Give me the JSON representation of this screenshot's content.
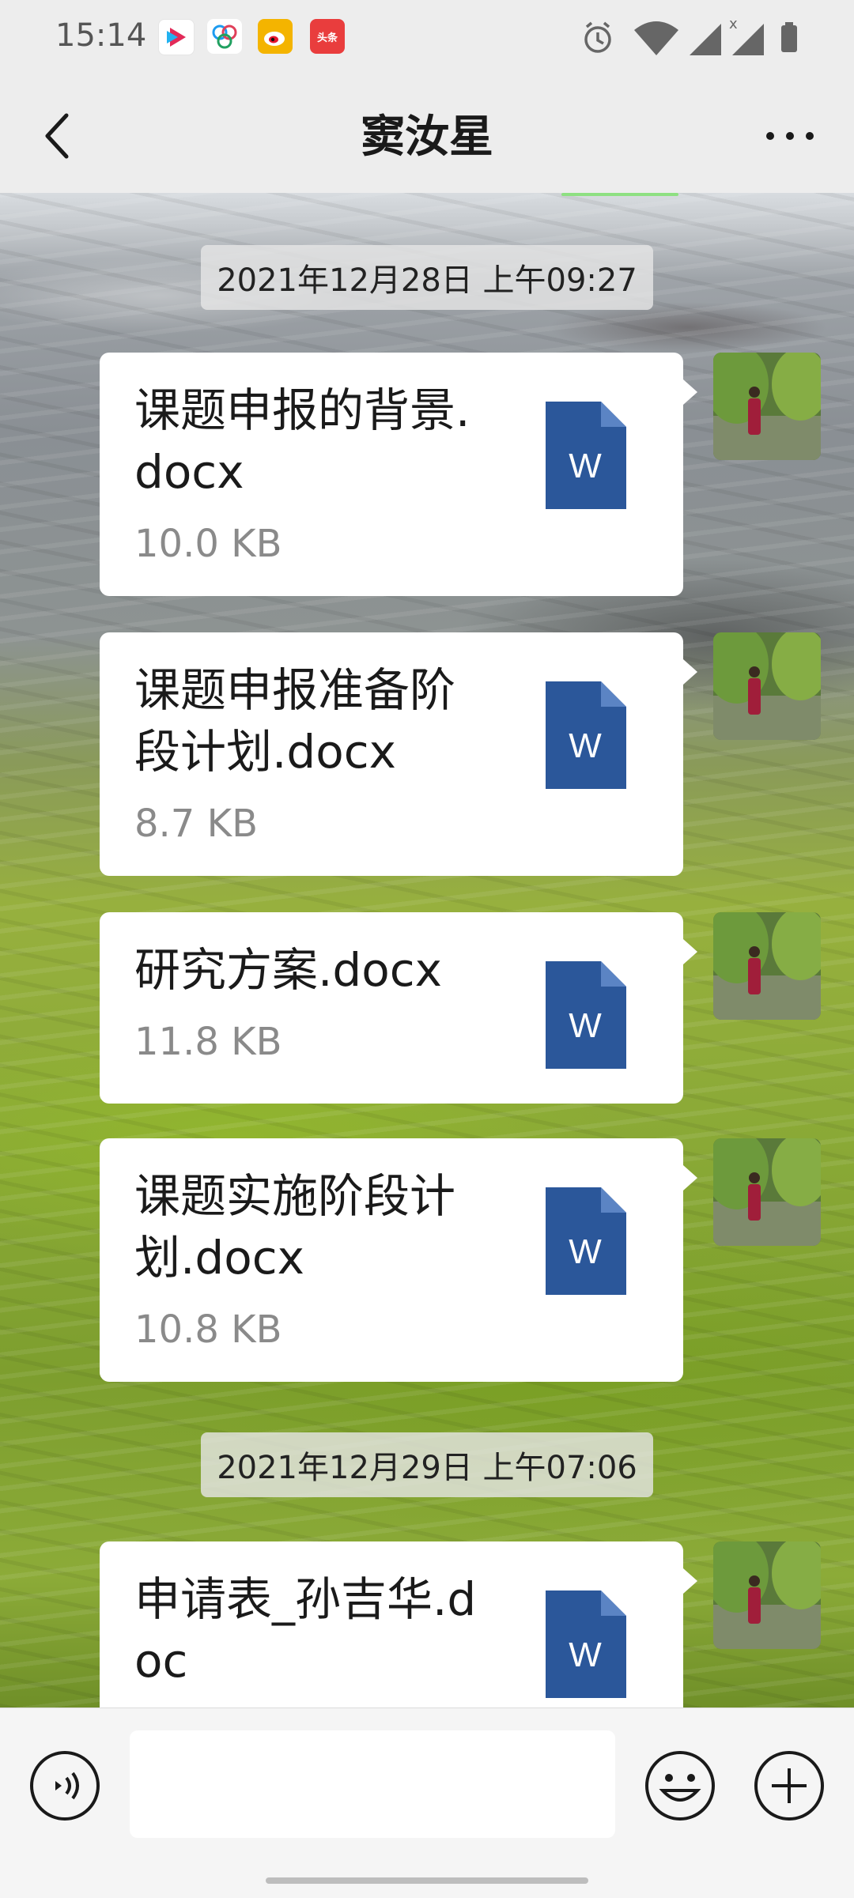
{
  "status_bar": {
    "time": "15:14",
    "apps": [
      {
        "icon": "youku-icon",
        "label": "YOUKU",
        "color": "#1fb6f2"
      },
      {
        "icon": "qq-app-icon",
        "label": "",
        "color": "#ffffff"
      },
      {
        "icon": "weibo-icon",
        "label": "",
        "color": "#f0b000"
      },
      {
        "icon": "toutiao-icon",
        "label": "头条",
        "color": "#e93d3d"
      }
    ],
    "right_icons": [
      "alarm-icon",
      "wifi-icon",
      "signal-icon",
      "signal-no-sim-icon",
      "battery-icon"
    ]
  },
  "header": {
    "title": "窦汝星",
    "back_icon": "chevron-left-icon",
    "more_icon": "more-dots-icon"
  },
  "chat": {
    "groups": [
      {
        "timestamp": "2021年12月28日 上午09:27",
        "messages": [
          {
            "file_name": "课题申报的背景.docx",
            "size": "10.0 KB",
            "file_icon": "word-doc-icon"
          },
          {
            "file_name": "课题申报准备阶段计划.docx",
            "size": "8.7 KB",
            "file_icon": "word-doc-icon"
          },
          {
            "file_name": "研究方案.docx",
            "size": "11.8 KB",
            "file_icon": "word-doc-icon"
          },
          {
            "file_name": "课题实施阶段计划.docx",
            "size": "10.8 KB",
            "file_icon": "word-doc-icon"
          }
        ]
      },
      {
        "timestamp": "2021年12月29日 上午07:06",
        "messages": [
          {
            "file_name": "申请表_孙吉华.doc",
            "size": "",
            "file_icon": "word-doc-icon"
          }
        ]
      }
    ],
    "word_icon_letter": "W",
    "word_icon_color": "#2b579a"
  },
  "input_bar": {
    "voice_icon": "voice-icon",
    "text_value": "",
    "emoji_icon": "emoji-icon",
    "plus_icon": "plus-circle-icon"
  }
}
